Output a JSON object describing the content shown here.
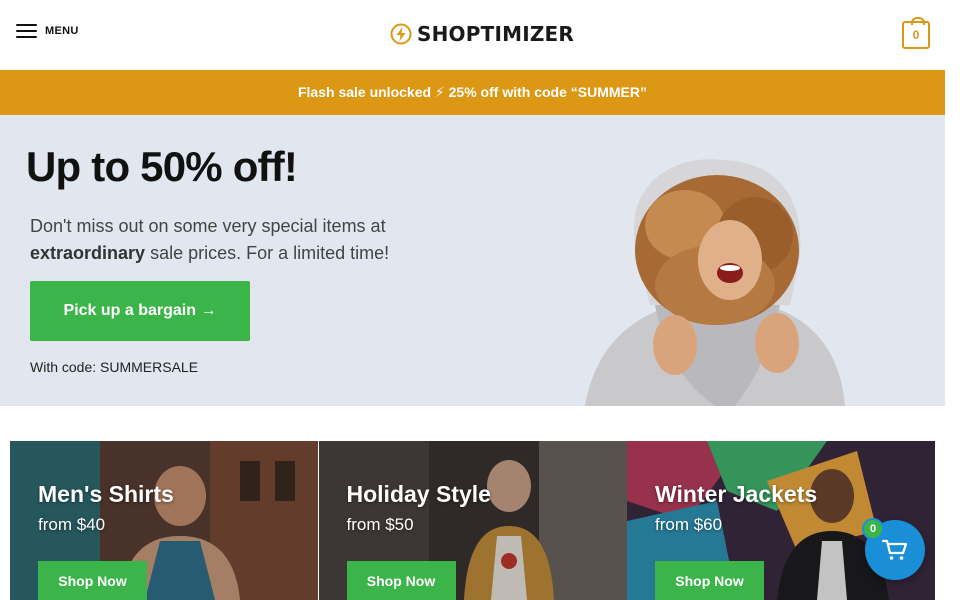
{
  "header": {
    "menu_label": "MENU",
    "logo_text": "SHOPTIMIZER",
    "cart_count": "0"
  },
  "flash_bar": {
    "text": "Flash sale unlocked ⚡ 25% off with code “SUMMER”"
  },
  "hero": {
    "title": "Up to 50% off!",
    "desc_part1": "Don't miss out on some very special items at ",
    "desc_bold": "extraordinary",
    "desc_part2": " sale prices. For a limited time!",
    "button_label": "Pick up a bargain →",
    "code_text": "With code: SUMMERSALE"
  },
  "categories": [
    {
      "title": "Men's Shirts",
      "price": "from $40",
      "button": "Shop Now"
    },
    {
      "title": "Holiday Style",
      "price": "from $50",
      "button": "Shop Now"
    },
    {
      "title": "Winter Jackets",
      "price": "from $60",
      "button": "Shop Now"
    }
  ],
  "floating_cart": {
    "count": "0",
    "icon": "cart-icon"
  },
  "colors": {
    "accent": "#dc9814",
    "green": "#3bb54a",
    "blue": "#1a8fd8",
    "hero_bg": "#e2e6ee"
  }
}
